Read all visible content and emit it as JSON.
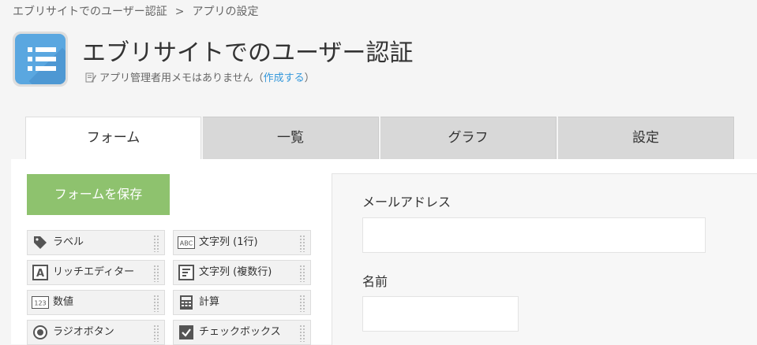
{
  "breadcrumb": {
    "app": "エブリサイトでのユーザー認証",
    "separator": ">",
    "current": "アプリの設定"
  },
  "app": {
    "title": "エブリサイトでのユーザー認証",
    "memo_text": "アプリ管理者用メモはありません（",
    "memo_link": "作成する",
    "memo_close": "）",
    "icon": "list-icon",
    "icon_color": "#5aa7e0"
  },
  "tabs": [
    {
      "label": "フォーム",
      "active": true
    },
    {
      "label": "一覧",
      "active": false
    },
    {
      "label": "グラフ",
      "active": false
    },
    {
      "label": "設定",
      "active": false
    }
  ],
  "save_button": {
    "label": "フォームを保存",
    "color": "#8ec26e"
  },
  "palette": [
    {
      "label": "ラベル",
      "icon": "tag-icon"
    },
    {
      "label": "文字列 (1行)",
      "icon": "abc-icon"
    },
    {
      "label": "リッチエディター",
      "icon": "rich-editor-icon"
    },
    {
      "label": "文字列 (複数行)",
      "icon": "multiline-icon"
    },
    {
      "label": "数値",
      "icon": "number-icon"
    },
    {
      "label": "計算",
      "icon": "calculator-icon"
    },
    {
      "label": "ラジオボタン",
      "icon": "radio-icon"
    },
    {
      "label": "チェックボックス",
      "icon": "checkbox-icon"
    }
  ],
  "form_fields": [
    {
      "label": "メールアドレス"
    },
    {
      "label": "名前"
    }
  ]
}
